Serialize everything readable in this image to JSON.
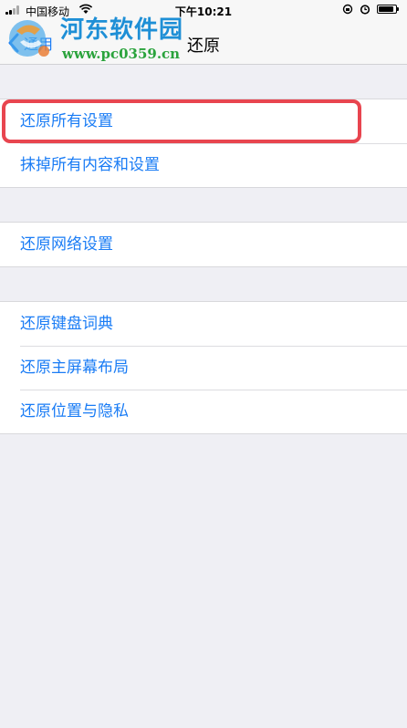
{
  "status_bar": {
    "carrier": "中国移动",
    "time": "下午10:21",
    "icons": [
      "signal-icon",
      "wifi-icon",
      "rotation-lock-icon",
      "alarm-icon",
      "battery-icon"
    ]
  },
  "nav": {
    "back_label": "通用",
    "title": "还原"
  },
  "watermark": {
    "title": "河东软件园",
    "url": "www.pc0359.cn"
  },
  "groups": [
    {
      "items": [
        "还原所有设置",
        "抹掉所有内容和设置"
      ]
    },
    {
      "items": [
        "还原网络设置"
      ]
    },
    {
      "items": [
        "还原键盘词典",
        "还原主屏幕布局",
        "还原位置与隐私"
      ]
    }
  ],
  "colors": {
    "accent": "#1a7cf5",
    "highlight": "#e8454f",
    "background": "#efeff4"
  }
}
